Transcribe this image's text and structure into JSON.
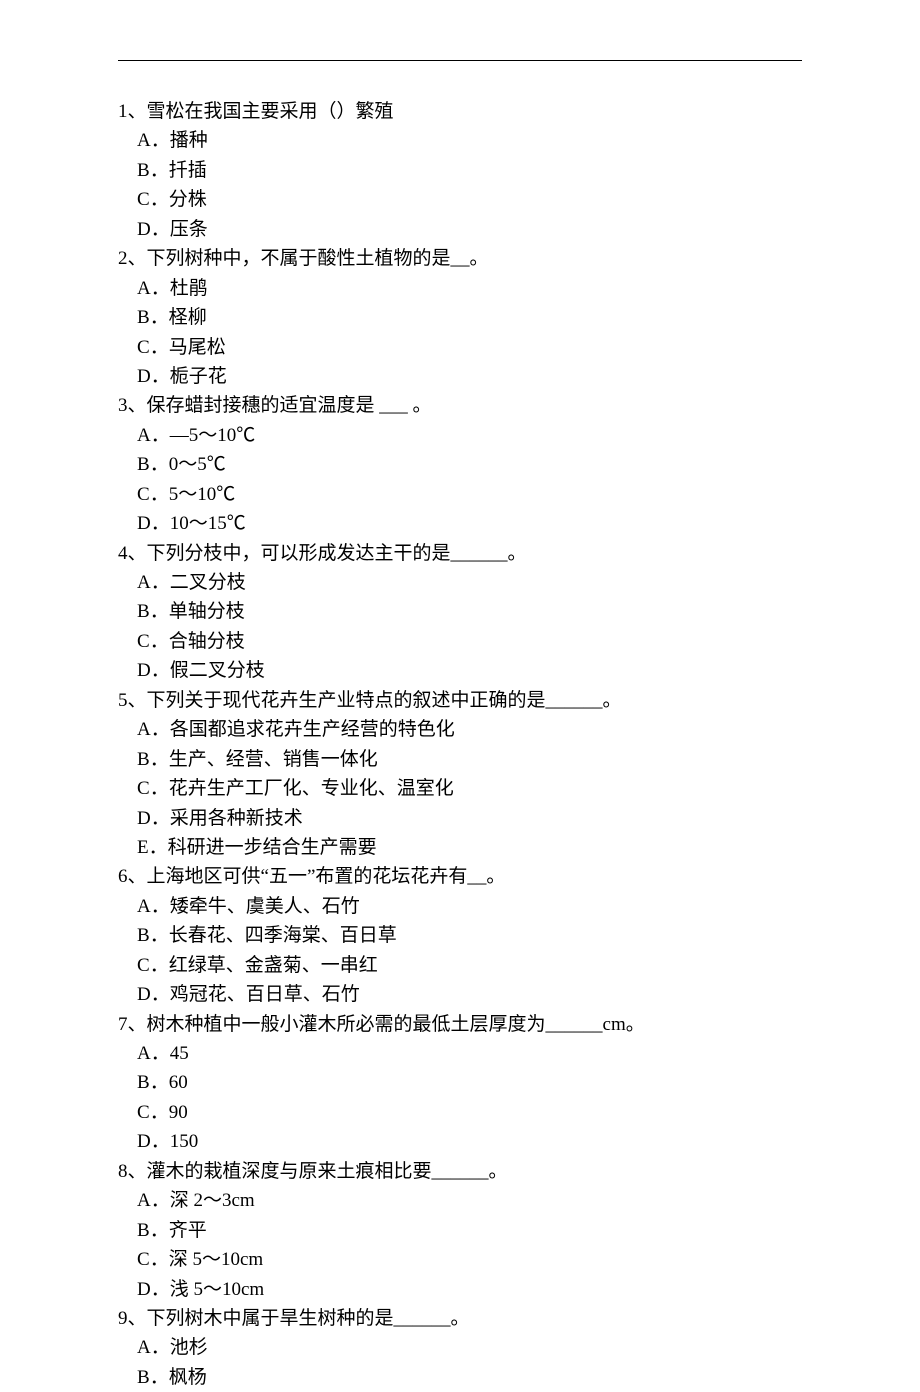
{
  "questions": [
    {
      "num": "1",
      "stem": "雪松在我国主要采用（）繁殖",
      "options": [
        "播种",
        "扦插",
        "分株",
        "压条"
      ]
    },
    {
      "num": "2",
      "stem": "下列树种中，不属于酸性土植物的是__。",
      "options": [
        "杜鹃",
        "柽柳",
        "马尾松",
        "栀子花"
      ]
    },
    {
      "num": "3",
      "stem": "保存蜡封接穗的适宜温度是  ___ 。",
      "options": [
        "―5～10℃",
        "0～5℃",
        "5～10℃",
        "10～15℃"
      ]
    },
    {
      "num": "4",
      "stem": "下列分枝中，可以形成发达主干的是______。",
      "options": [
        "二叉分枝",
        "单轴分枝",
        "合轴分枝",
        "假二叉分枝"
      ]
    },
    {
      "num": "5",
      "stem": "下列关于现代花卉生产业特点的叙述中正确的是______。",
      "options": [
        "各国都追求花卉生产经营的特色化",
        "生产、经营、销售一体化",
        "花卉生产工厂化、专业化、温室化",
        "采用各种新技术",
        "科研进一步结合生产需要"
      ]
    },
    {
      "num": "6",
      "stem": "上海地区可供“五一”布置的花坛花卉有__。",
      "options": [
        "矮牵牛、虞美人、石竹",
        "长春花、四季海棠、百日草",
        "红绿草、金盏菊、一串红",
        "鸡冠花、百日草、石竹"
      ]
    },
    {
      "num": "7",
      "stem": "树木种植中一般小灌木所必需的最低土层厚度为______cm。",
      "options": [
        "45",
        "60",
        "90",
        "150"
      ]
    },
    {
      "num": "8",
      "stem": "灌木的栽植深度与原来土痕相比要______。",
      "options": [
        "深 2～3cm",
        "齐平",
        "深 5～10cm",
        "浅 5～10cm"
      ]
    },
    {
      "num": "9",
      "stem": "下列树木中属于旱生树种的是______。",
      "options": [
        "池杉",
        "枫杨"
      ]
    }
  ],
  "labels": {
    "letters": [
      "A",
      "B",
      "C",
      "D",
      "E"
    ],
    "num_sep": "、",
    "opt_sep": "．"
  }
}
